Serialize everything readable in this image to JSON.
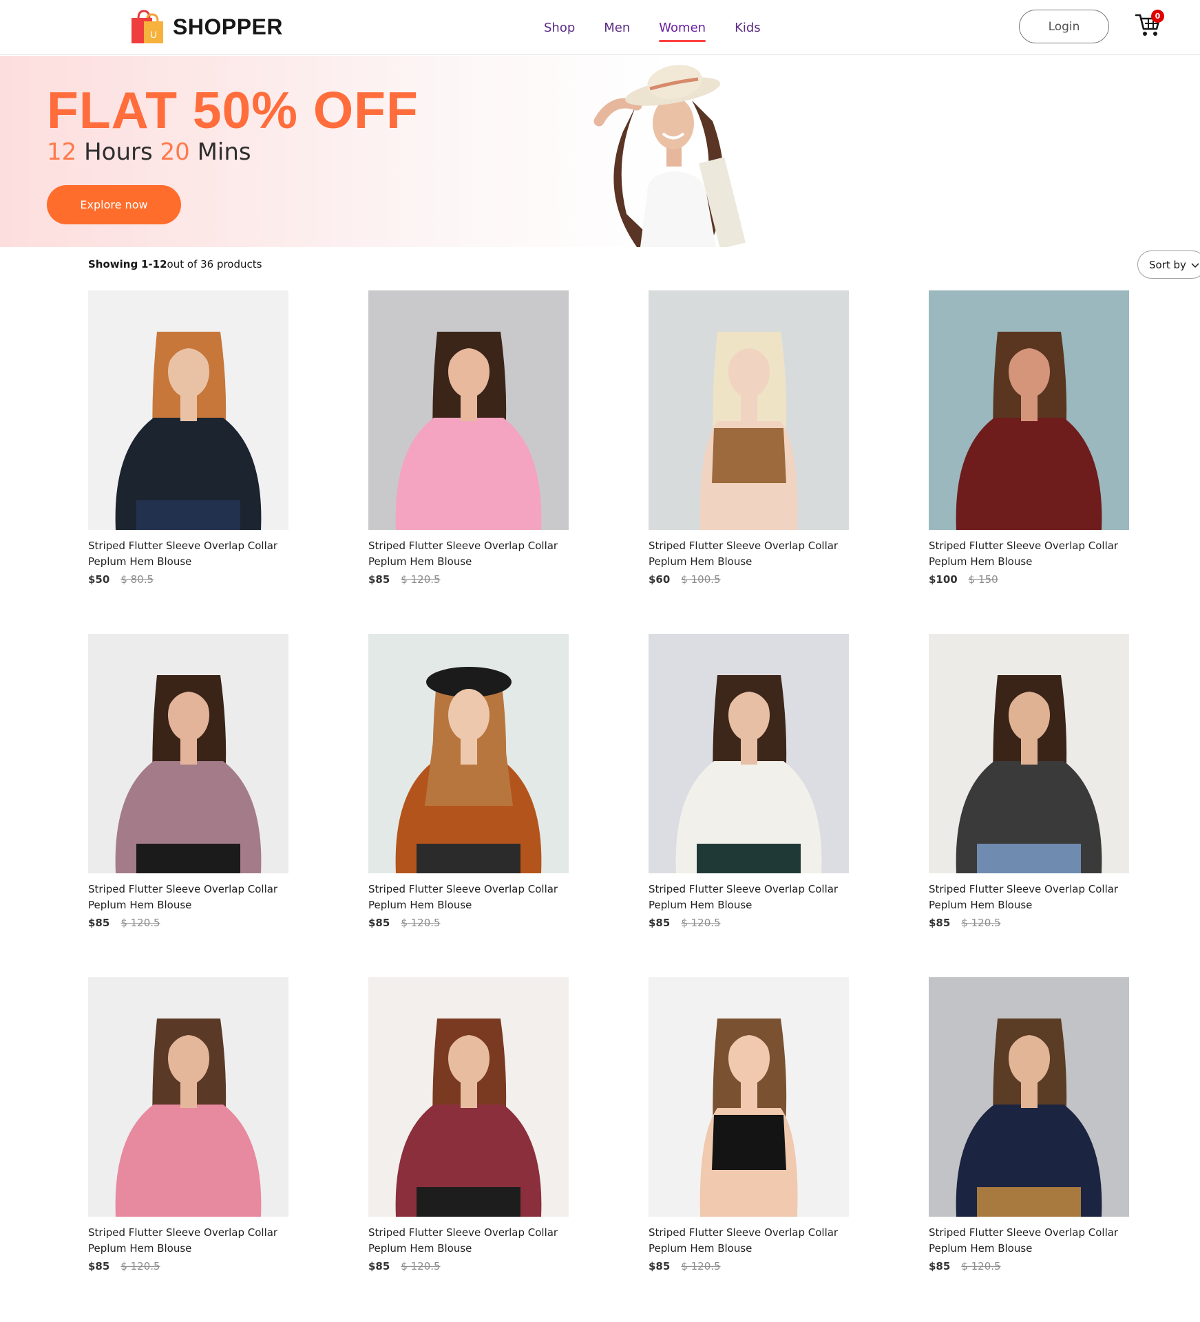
{
  "brand": {
    "name": "SHOPPER",
    "logo_letter": "U"
  },
  "nav": {
    "items": [
      {
        "label": "Shop",
        "active": false
      },
      {
        "label": "Men",
        "active": false
      },
      {
        "label": "Women",
        "active": true
      },
      {
        "label": "Kids",
        "active": false
      }
    ],
    "login_label": "Login",
    "cart_count": "0"
  },
  "hero": {
    "title": "FLAT 50% OFF",
    "timer_hours": "12",
    "timer_hours_label": "Hours",
    "timer_mins": "20",
    "timer_mins_label": "Mins",
    "cta_label": "Explore now"
  },
  "toolbar": {
    "showing_label": "Showing",
    "range": "1-12",
    "range_suffix": "out of 36 products",
    "sort_label": "Sort by",
    "sort_icon": "chevron-down-icon"
  },
  "products": [
    {
      "name": "Striped Flutter Sleeve Overlap Collar Peplum Hem Blouse",
      "new_price": "$50",
      "old_price": "$ 80.5",
      "image": {
        "bg": "#f1f1f1",
        "skin": "#e9c2a6",
        "hair": "#c7773a",
        "top": "#1c2430",
        "bottom": "#22314e",
        "style": "jacket"
      }
    },
    {
      "name": "Striped Flutter Sleeve Overlap Collar Peplum Hem Blouse",
      "new_price": "$85",
      "old_price": "$ 120.5",
      "image": {
        "bg": "#c9c9cb",
        "skin": "#e8b99d",
        "hair": "#3b2519",
        "top": "#f4a4c0",
        "bottom": "#f4a4c0",
        "style": "tee"
      }
    },
    {
      "name": "Striped Flutter Sleeve Overlap Collar Peplum Hem Blouse",
      "new_price": "$60",
      "old_price": "$ 100.5",
      "image": {
        "bg": "#d7dbdc",
        "skin": "#f0d3c0",
        "hair": "#efe3c6",
        "top": "#9c6a3c",
        "bottom": "#d7dbdc",
        "style": "crop"
      }
    },
    {
      "name": "Striped Flutter Sleeve Overlap Collar Peplum Hem Blouse",
      "new_price": "$100",
      "old_price": "$ 150",
      "image": {
        "bg": "#9ab8bd",
        "skin": "#d4957a",
        "hair": "#5a3520",
        "top": "#6e1c1c",
        "bottom": "#6e1c1c",
        "style": "wrap"
      }
    },
    {
      "name": "Striped Flutter Sleeve Overlap Collar Peplum Hem Blouse",
      "new_price": "$85",
      "old_price": "$ 120.5",
      "image": {
        "bg": "#ececec",
        "skin": "#e3b49a",
        "hair": "#3a2418",
        "top": "#a47b88",
        "bottom": "#1b1b1b",
        "style": "blouse"
      }
    },
    {
      "name": "Striped Flutter Sleeve Overlap Collar Peplum Hem Blouse",
      "new_price": "$85",
      "old_price": "$ 120.5",
      "image": {
        "bg": "#e3e9e7",
        "skin": "#edc8ad",
        "hair": "#b8763f",
        "top": "#b3541c",
        "bottom": "#2b2b2b",
        "style": "hijab"
      }
    },
    {
      "name": "Striped Flutter Sleeve Overlap Collar Peplum Hem Blouse",
      "new_price": "$85",
      "old_price": "$ 120.5",
      "image": {
        "bg": "#dcdde2",
        "skin": "#e7bfa5",
        "hair": "#3d261a",
        "top": "#f2f0ea",
        "bottom": "#1f3a36",
        "style": "turtle"
      }
    },
    {
      "name": "Striped Flutter Sleeve Overlap Collar Peplum Hem Blouse",
      "new_price": "$85",
      "old_price": "$ 120.5",
      "image": {
        "bg": "#ecebe7",
        "skin": "#e0b294",
        "hair": "#3a2418",
        "top": "#3a3a3a",
        "bottom": "#6f8bb0",
        "style": "floral"
      }
    },
    {
      "name": "Striped Flutter Sleeve Overlap Collar Peplum Hem Blouse",
      "new_price": "$85",
      "old_price": "$ 120.5",
      "image": {
        "bg": "#efeeee",
        "skin": "#e4b79b",
        "hair": "#5a3a26",
        "top": "#e7899f",
        "bottom": "#e7899f",
        "style": "floral-long"
      }
    },
    {
      "name": "Striped Flutter Sleeve Overlap Collar Peplum Hem Blouse",
      "new_price": "$85",
      "old_price": "$ 120.5",
      "image": {
        "bg": "#f2efec",
        "skin": "#e8bc9f",
        "hair": "#7a3a22",
        "top": "#8b2f3c",
        "bottom": "#1d1d1d",
        "style": "hoodie"
      }
    },
    {
      "name": "Striped Flutter Sleeve Overlap Collar Peplum Hem Blouse",
      "new_price": "$85",
      "old_price": "$ 120.5",
      "image": {
        "bg": "#f2f2f2",
        "skin": "#f0c9ae",
        "hair": "#7a5232",
        "top": "#141414",
        "bottom": "#f0c9ae",
        "style": "bralette"
      }
    },
    {
      "name": "Striped Flutter Sleeve Overlap Collar Peplum Hem Blouse",
      "new_price": "$85",
      "old_price": "$ 120.5",
      "image": {
        "bg": "#c2c3c6",
        "skin": "#e2b596",
        "hair": "#5b3c25",
        "top": "#1b2440",
        "bottom": "#a87a3f",
        "style": "sweater"
      }
    }
  ],
  "colors": {
    "accent": "#ff6d2c",
    "hero_title": "#ff6d3c",
    "nav_text": "#5b2a86",
    "active_underline": "#ff4141",
    "badge": "#e00000"
  }
}
